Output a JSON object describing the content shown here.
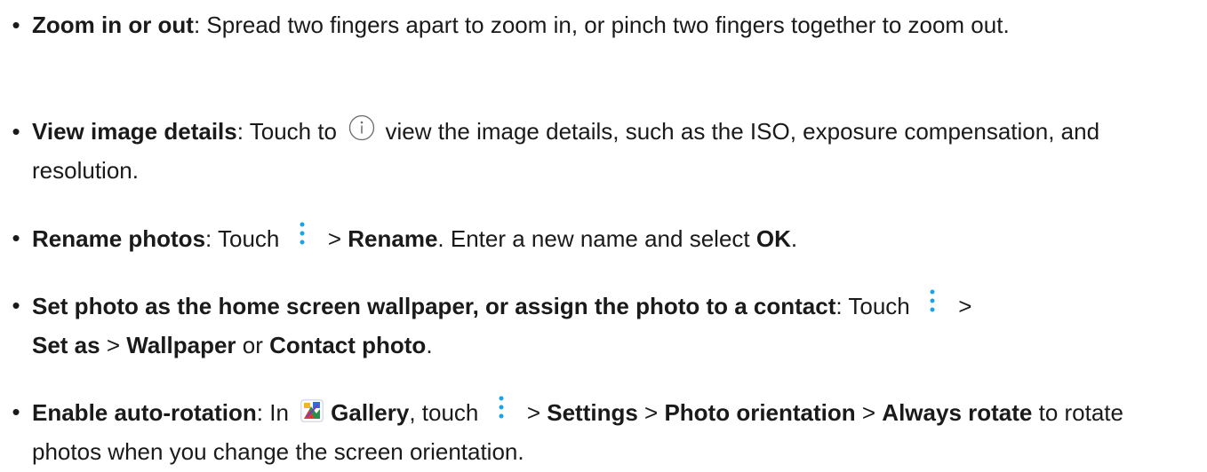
{
  "items": [
    {
      "title": "Zoom in or out",
      "text": ": Spread two fingers apart to zoom in, or pinch two fingers together to zoom out."
    },
    {
      "title": "View image details",
      "text_before_icon": ": Touch to ",
      "icon": "info-icon",
      "text_after_icon": " view the image details, such as the ISO, exposure compensation, and resolution."
    },
    {
      "title": "Rename photos",
      "text_before_icon": ": Touch ",
      "icon": "more-vertical-icon",
      "text_between": " > ",
      "rename": "Rename",
      "text_end": ". Enter a new name and select ",
      "ok": "OK",
      "period": "."
    },
    {
      "title": "Set photo as the home screen wallpaper, or assign the photo to a contact",
      "text_before_icon": ": Touch ",
      "icon": "more-vertical-icon",
      "gt1": " >",
      "set_as": "Set as",
      "gt2": " > ",
      "wallpaper": "Wallpaper",
      "or": " or ",
      "contact_photo": "Contact photo",
      "period": "."
    },
    {
      "title": "Enable auto-rotation",
      "in": ": In ",
      "gallery_icon": "gallery-icon",
      "gallery": "Gallery",
      "touch": ", touch ",
      "icon": "more-vertical-icon",
      "gt1": " > ",
      "settings": "Settings",
      "gt2": " > ",
      "photo_orientation": "Photo orientation",
      "gt3": " > ",
      "always_rotate": "Always rotate",
      "tail": " to rotate photos when you change the screen orientation."
    }
  ],
  "colors": {
    "text": "#1a1a1a",
    "accent": "#1aa3e8"
  }
}
